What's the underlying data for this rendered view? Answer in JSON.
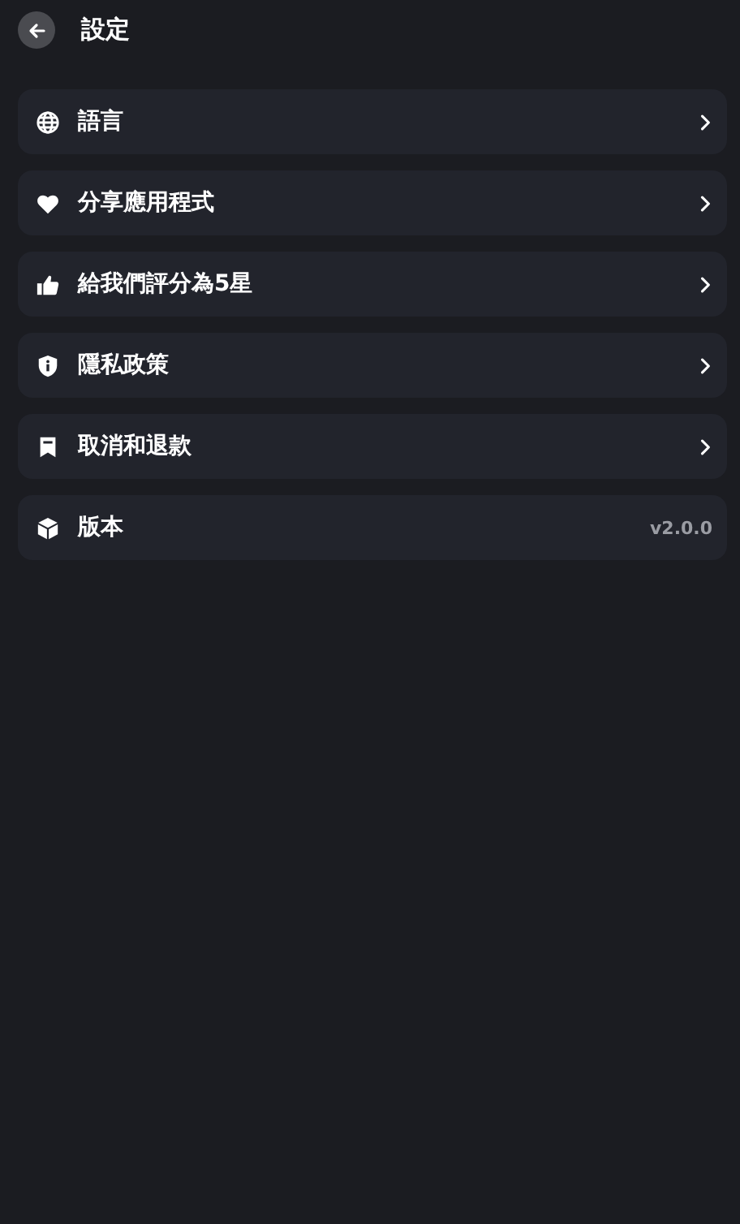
{
  "header": {
    "title": "設定"
  },
  "items": [
    {
      "kind": "link",
      "label": "語言"
    },
    {
      "kind": "link",
      "label": "分享應用程式"
    },
    {
      "kind": "link",
      "label": "給我們評分為5星"
    },
    {
      "kind": "link",
      "label": "隱私政策"
    },
    {
      "kind": "link",
      "label": "取消和退款"
    },
    {
      "kind": "info",
      "label": "版本",
      "value": "v2.0.0"
    }
  ]
}
